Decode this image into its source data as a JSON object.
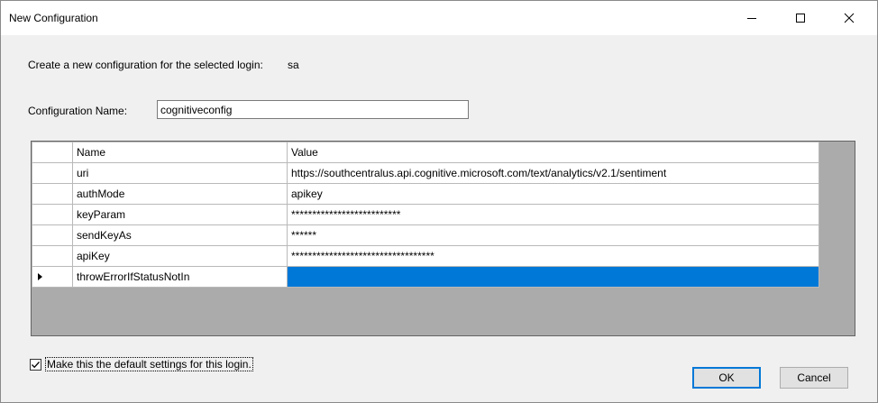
{
  "window": {
    "title": "New Configuration",
    "controls": [
      "minimize",
      "maximize",
      "close"
    ]
  },
  "prompt": {
    "text": "Create a new configuration for the selected login:",
    "login": "sa"
  },
  "config_name": {
    "label": "Configuration Name:",
    "value": "cognitiveconfig"
  },
  "grid": {
    "columns": [
      "Name",
      "Value"
    ],
    "rows": [
      {
        "name": "uri",
        "value": "https://southcentralus.api.cognitive.microsoft.com/text/analytics/v2.1/sentiment"
      },
      {
        "name": "authMode",
        "value": "apikey"
      },
      {
        "name": "keyParam",
        "value": "**************************"
      },
      {
        "name": "sendKeyAs",
        "value": "******"
      },
      {
        "name": "apiKey",
        "value": "**********************************"
      },
      {
        "name": "throwErrorIfStatusNotIn",
        "value": ""
      }
    ],
    "selected_row": 5
  },
  "default_checkbox": {
    "checked": true,
    "label": "Make this the default settings for this login."
  },
  "buttons": {
    "ok": "OK",
    "cancel": "Cancel"
  }
}
